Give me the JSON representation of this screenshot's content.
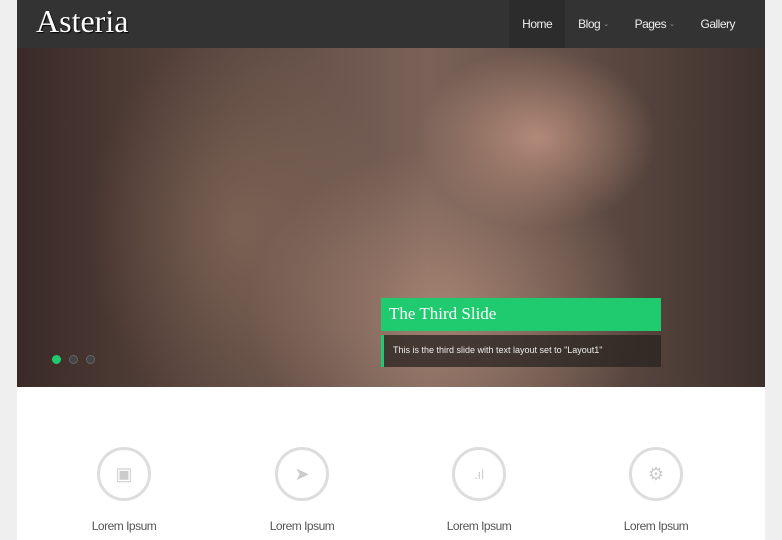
{
  "header": {
    "logo": "Asteria",
    "nav": [
      {
        "label": "Home",
        "active": true
      },
      {
        "label": "Blog",
        "dropdown": true
      },
      {
        "label": "Pages",
        "dropdown": true
      },
      {
        "label": "Gallery"
      }
    ]
  },
  "slider": {
    "title": "The Third Slide",
    "description": "This is the third slide with text layout set to \"Layout1\"",
    "slide_count": 3,
    "active_slide": 1,
    "accent": "#1fcb6e"
  },
  "features": [
    {
      "icon": "camera-icon",
      "label": "Lorem Ipsum"
    },
    {
      "icon": "rocket-icon",
      "label": "Lorem Ipsum"
    },
    {
      "icon": "signal-icon",
      "label": "Lorem Ipsum"
    },
    {
      "icon": "gears-icon",
      "label": "Lorem Ipsum"
    }
  ]
}
